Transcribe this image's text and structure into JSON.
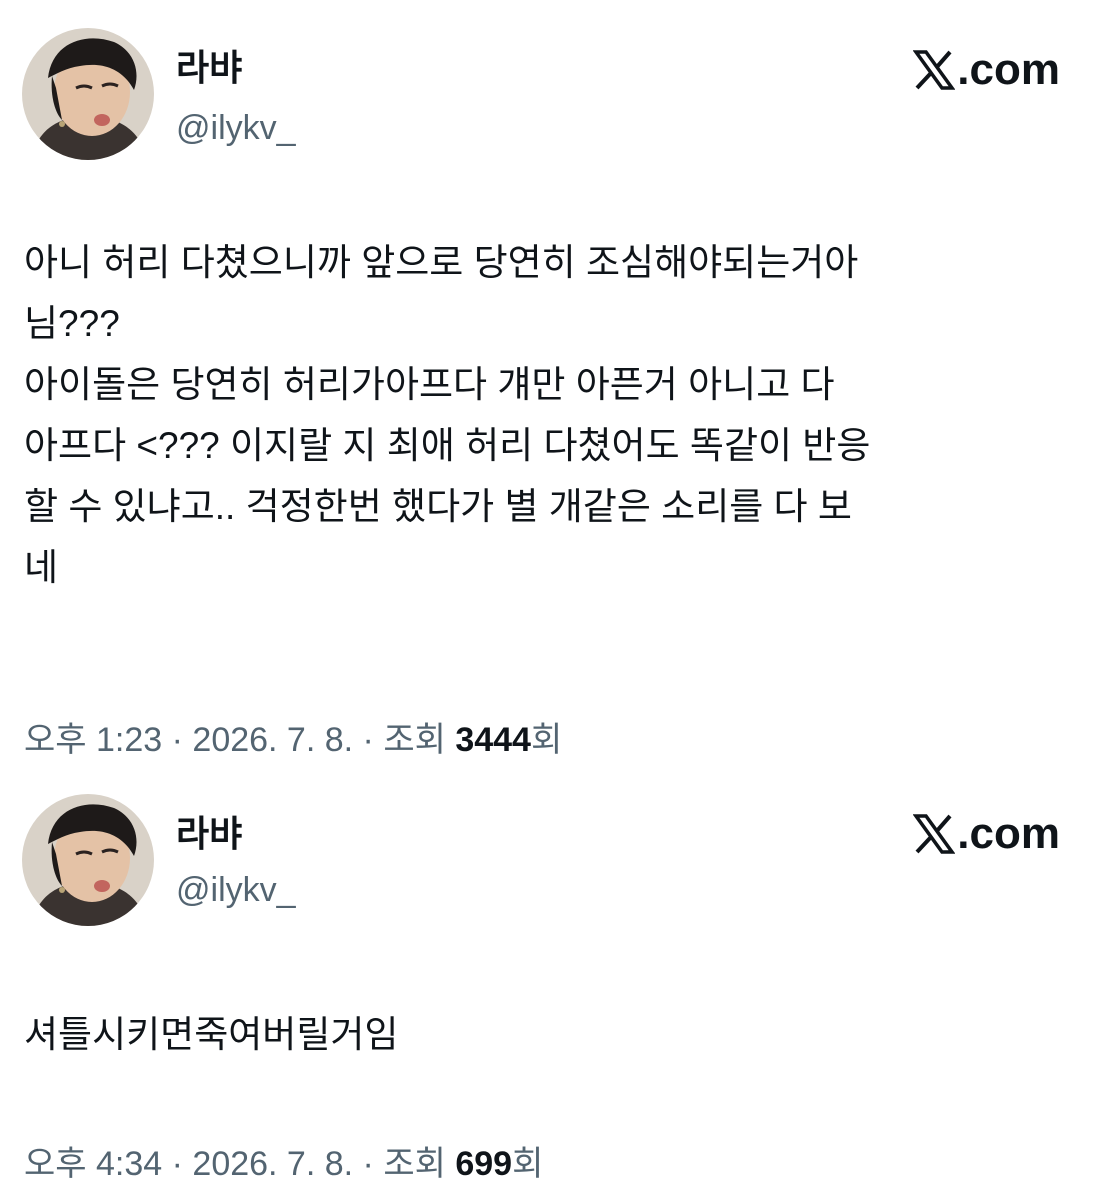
{
  "brand": {
    "label": ".com",
    "icon": "x-logo-icon"
  },
  "tweets": [
    {
      "display_name": "라뱌",
      "handle": "@ilykv_",
      "text": "아니 허리 다쳤으니까 앞으로 당연히 조심해야되는거아\n님???\n아이돌은 당연히 허리가아프다 걔만 아픈거 아니고 다\n아프다 <??? 이지랄 지 최애 허리 다쳤어도 똑같이 반응\n할 수 있냐고.. 걱정한번 했다가 별 개같은 소리를 다 보\n네",
      "time": "오후 1:23",
      "sep1": " · ",
      "date": "2026. 7. 8.",
      "sep2": " · ",
      "views_label": "조회 ",
      "views_count": "3444",
      "views_suffix": "회"
    },
    {
      "display_name": "라뱌",
      "handle": "@ilykv_",
      "text": "셔틀시키면죽여버릴거임",
      "time": "오후 4:34",
      "sep1": " · ",
      "date": "2026. 7. 8.",
      "sep2": " · ",
      "views_label": "조회 ",
      "views_count": "699",
      "views_suffix": "회"
    }
  ],
  "colors": {
    "text_primary": "#0f1419",
    "text_secondary": "#536471",
    "background": "#ffffff"
  }
}
